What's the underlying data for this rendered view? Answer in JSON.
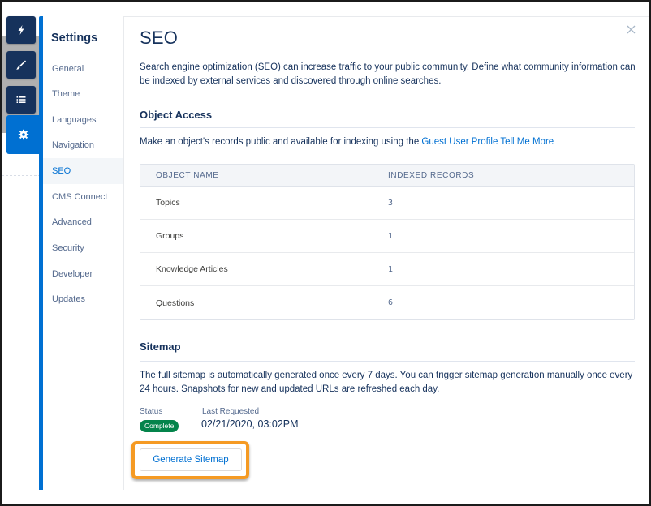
{
  "tool_strip": {
    "buttons": [
      {
        "name": "builder",
        "icon": "lightning-bolt-icon"
      },
      {
        "name": "theme",
        "icon": "paintbrush-icon"
      },
      {
        "name": "pages",
        "icon": "list-icon"
      },
      {
        "name": "settings",
        "icon": "gear-icon",
        "active": true
      }
    ]
  },
  "nav": {
    "title": "Settings",
    "items": [
      {
        "label": "General"
      },
      {
        "label": "Theme"
      },
      {
        "label": "Languages"
      },
      {
        "label": "Navigation"
      },
      {
        "label": "SEO",
        "selected": true
      },
      {
        "label": "CMS Connect"
      },
      {
        "label": "Advanced"
      },
      {
        "label": "Security"
      },
      {
        "label": "Developer"
      },
      {
        "label": "Updates"
      }
    ]
  },
  "page": {
    "title": "SEO",
    "intro": "Search engine optimization (SEO) can increase traffic to your public community. Define what community information can be indexed by external services and discovered through online searches.",
    "close_icon": "close-icon"
  },
  "object_access": {
    "title": "Object Access",
    "text": "Make an object's records public and available for indexing using the ",
    "link_guest": "Guest User Profile",
    "link_more": "Tell Me More",
    "table": {
      "headers": [
        "OBJECT NAME",
        "INDEXED RECORDS"
      ],
      "rows": [
        {
          "name": "Topics",
          "count": "3"
        },
        {
          "name": "Groups",
          "count": "1"
        },
        {
          "name": "Knowledge Articles",
          "count": "1"
        },
        {
          "name": "Questions",
          "count": "6"
        }
      ]
    }
  },
  "sitemap": {
    "title": "Sitemap",
    "text": "The full sitemap is automatically generated once every 7 days. You can trigger sitemap generation manually once every 24 hours. Snapshots for new and updated URLs are refreshed each day.",
    "status_label": "Status",
    "status_value": "Complete",
    "last_requested_label": "Last Requested",
    "last_requested_value": "02/21/2020, 03:02PM",
    "generate_button": "Generate Sitemap"
  },
  "colors": {
    "brand_blue": "#0070d2",
    "navy": "#16325c",
    "success": "#04844b",
    "highlight": "#f59a23"
  }
}
